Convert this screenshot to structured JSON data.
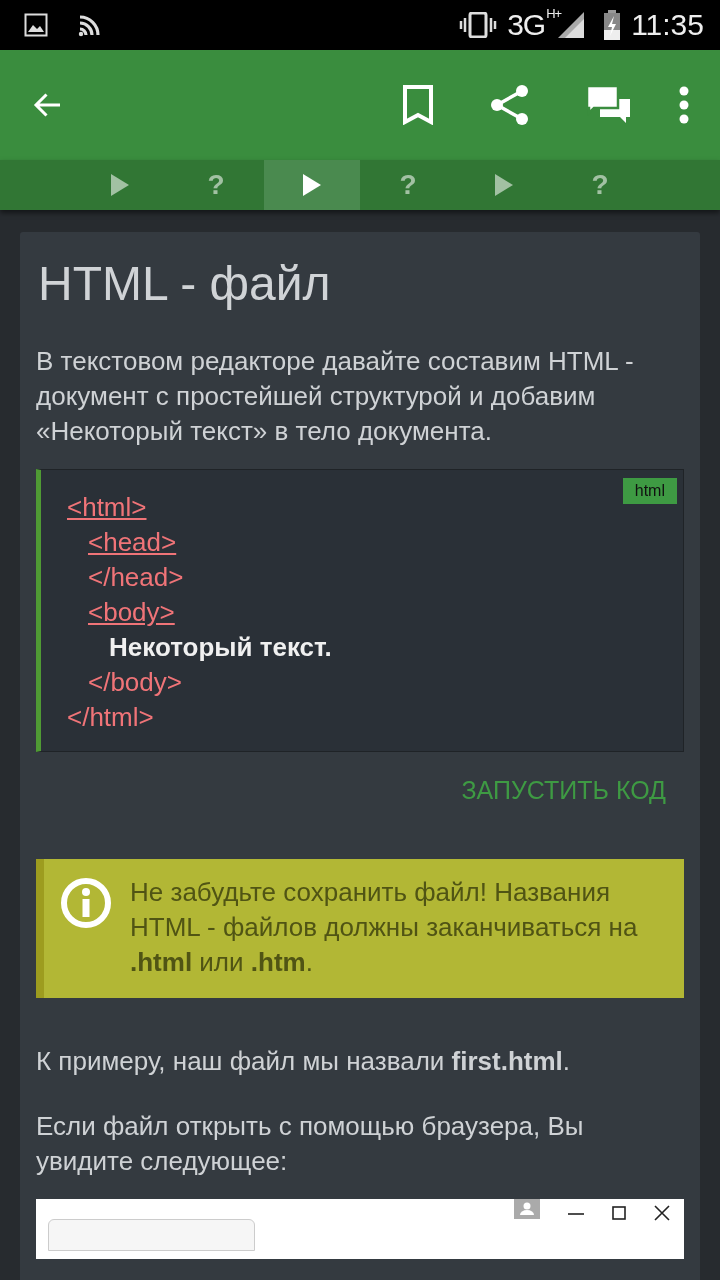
{
  "status_bar": {
    "network": "3G",
    "network_badge": "H+",
    "time": "11:35"
  },
  "tabs": [
    {
      "kind": "play",
      "selected": false
    },
    {
      "kind": "question",
      "label": "?",
      "selected": false
    },
    {
      "kind": "play",
      "selected": true
    },
    {
      "kind": "question",
      "label": "?",
      "selected": false
    },
    {
      "kind": "play",
      "selected": false
    },
    {
      "kind": "question",
      "label": "?",
      "selected": false
    }
  ],
  "lesson": {
    "title": "HTML - файл",
    "intro": "В текстовом редакторе давайте составим HTML - документ с простейшей структурой и добавим «Некоторый текст» в тело документа.",
    "code": {
      "language": "html",
      "lines": [
        {
          "kind": "tag",
          "text": "<html>",
          "link": true,
          "children": [
            {
              "kind": "tag",
              "text": "<head>",
              "link": true
            },
            {
              "kind": "tag",
              "text": "</head>",
              "link": false
            },
            {
              "kind": "tag",
              "text": "<body>",
              "link": true,
              "children": [
                {
                  "kind": "text",
                  "text": "Некоторый текст.",
                  "link": false
                }
              ]
            },
            {
              "kind": "tag",
              "text": "</body>",
              "link": false
            }
          ]
        },
        {
          "kind": "tag",
          "text": "</html>",
          "link": false
        }
      ]
    },
    "run_button": "ЗАПУСТИТЬ КОД",
    "note": "Не забудьте сохранить файл! Названия HTML - файлов должны заканчиваться на **.html** или **.htm**.",
    "paragraphs": [
      "К примеру, наш файл мы назвали **first.html**.",
      "Если файл открыть с помощью браузера, Вы увидите следующее:"
    ]
  }
}
